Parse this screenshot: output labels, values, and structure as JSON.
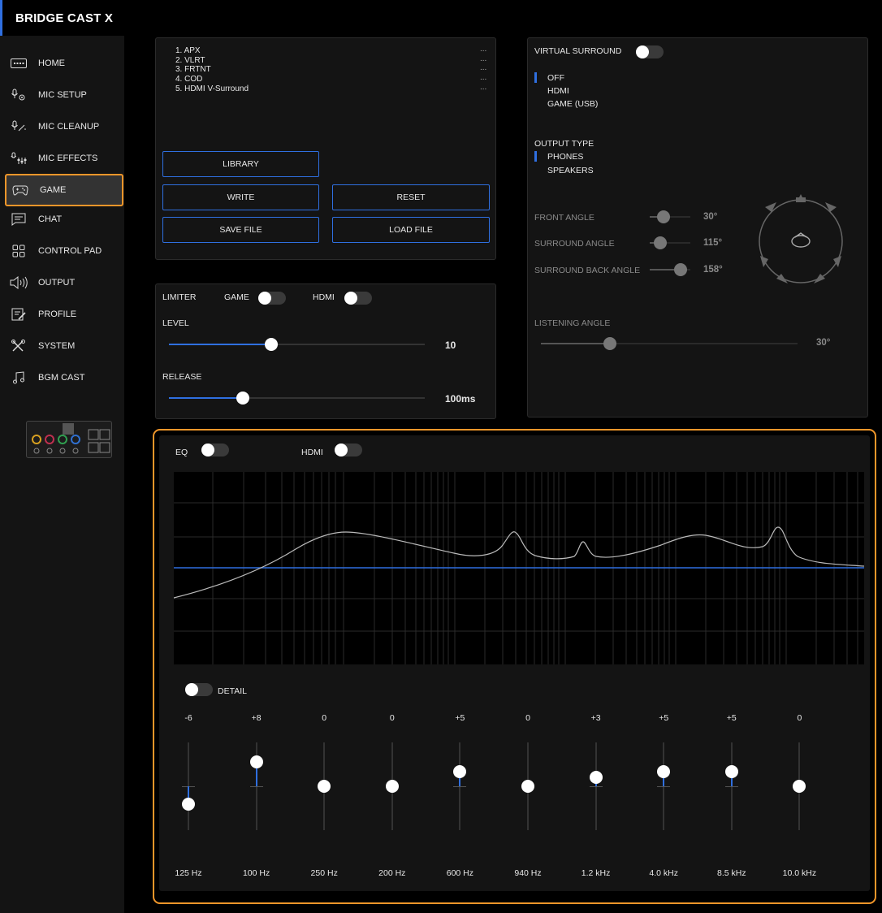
{
  "app": {
    "title": "BRIDGE CAST X"
  },
  "sidebar": {
    "items": [
      {
        "label": "HOME",
        "icon": "keyboard-icon"
      },
      {
        "label": "MIC SETUP",
        "icon": "mic-gear-icon"
      },
      {
        "label": "MIC CLEANUP",
        "icon": "mic-clean-icon"
      },
      {
        "label": "MIC EFFECTS",
        "icon": "mic-effects-icon"
      },
      {
        "label": "GAME",
        "icon": "gamepad-icon",
        "active": true
      },
      {
        "label": "CHAT",
        "icon": "chat-icon"
      },
      {
        "label": "CONTROL PAD",
        "icon": "grid-icon"
      },
      {
        "label": "OUTPUT",
        "icon": "speaker-icon"
      },
      {
        "label": "PROFILE",
        "icon": "profile-edit-icon"
      },
      {
        "label": "SYSTEM",
        "icon": "tools-icon"
      },
      {
        "label": "BGM CAST",
        "icon": "music-note-icon"
      }
    ]
  },
  "presets": {
    "items": [
      {
        "name": "1. APX",
        "value": "..."
      },
      {
        "name": "2. VLRT",
        "value": "..."
      },
      {
        "name": "3. FRTNT",
        "value": "..."
      },
      {
        "name": "4. COD",
        "value": "..."
      },
      {
        "name": "5. HDMI V-Surround",
        "value": "..."
      }
    ],
    "buttons": {
      "library": "LIBRARY",
      "write": "WRITE",
      "reset": "RESET",
      "save_file": "SAVE FILE",
      "load_file": "LOAD FILE"
    }
  },
  "limiter": {
    "label": "LIMITER",
    "game_label": "GAME",
    "hdmi_label": "HDMI",
    "level": {
      "label": "LEVEL",
      "value": "10",
      "fraction": 0.4
    },
    "release": {
      "label": "RELEASE",
      "value": "100ms",
      "fraction": 0.29
    }
  },
  "surround": {
    "label": "VIRTUAL SURROUND",
    "modes": [
      "OFF",
      "HDMI",
      "GAME (USB)"
    ],
    "selected_mode": "OFF",
    "output_type": {
      "label": "OUTPUT TYPE",
      "options": [
        "PHONES",
        "SPEAKERS"
      ],
      "selected": "PHONES"
    },
    "angles": [
      {
        "label": "FRONT ANGLE",
        "value": "30°",
        "fraction": 0.33
      },
      {
        "label": "SURROUND ANGLE",
        "value": "115°",
        "fraction": 0.25
      },
      {
        "label": "SURROUND BACK ANGLE",
        "value": "158°",
        "fraction": 0.75
      }
    ],
    "listening_angle": {
      "label": "LISTENING ANGLE",
      "value": "30°",
      "fraction": 0.27
    }
  },
  "eq": {
    "label": "EQ",
    "hdmi_label": "HDMI",
    "detail_label": "DETAIL",
    "bands": [
      {
        "gain": "-6",
        "freq": "125 Hz",
        "level": -6
      },
      {
        "gain": "+8",
        "freq": "100 Hz",
        "level": 8
      },
      {
        "gain": "0",
        "freq": "250 Hz",
        "level": 0
      },
      {
        "gain": "0",
        "freq": "200 Hz",
        "level": 0
      },
      {
        "gain": "+5",
        "freq": "600 Hz",
        "level": 5
      },
      {
        "gain": "0",
        "freq": "940 Hz",
        "level": 0
      },
      {
        "gain": "+3",
        "freq": "1.2 kHz",
        "level": 3
      },
      {
        "gain": "+5",
        "freq": "4.0 kHz",
        "level": 5
      },
      {
        "gain": "+5",
        "freq": "8.5 kHz",
        "level": 5
      },
      {
        "gain": "0",
        "freq": "10.0 kHz",
        "level": 0
      }
    ]
  },
  "colors": {
    "accent": "#2f6fe0",
    "highlight": "#f0962a"
  }
}
